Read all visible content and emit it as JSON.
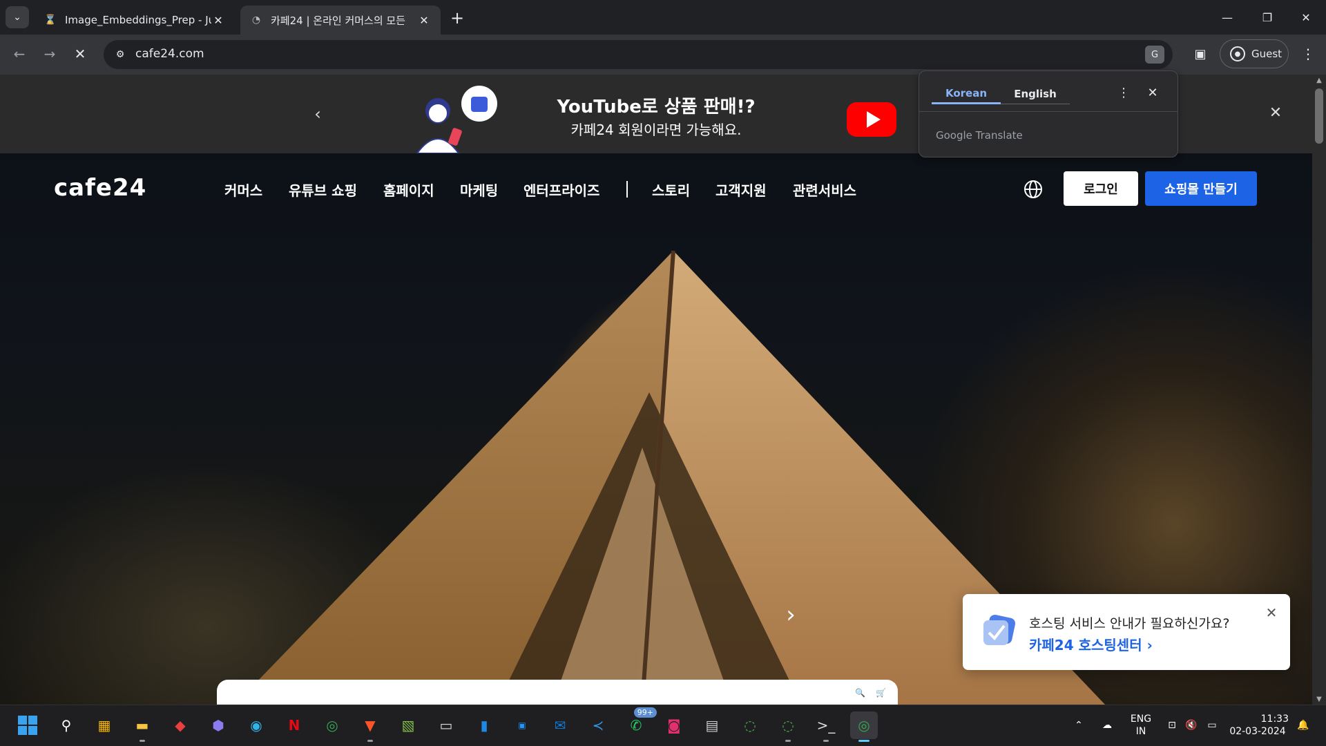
{
  "browser": {
    "tabs": [
      {
        "title": "Image_Embeddings_Prep - Jupy",
        "favicon": "hourglass-icon",
        "active": false
      },
      {
        "title": "카페24 | 온라인 커머스의 모든",
        "favicon": "loading-icon",
        "active": true
      }
    ],
    "url": "cafe24.com",
    "profile_label": "Guest"
  },
  "translate_popup": {
    "source_lang": "Korean",
    "target_lang": "English",
    "brand": "Google Translate"
  },
  "banner": {
    "title": "YouTube로 상품 판매!?",
    "subtitle": "카페24 회원이라면 가능해요."
  },
  "site": {
    "logo": "cafe24",
    "nav": [
      "커머스",
      "유튜브 쇼핑",
      "홈페이지",
      "마케팅",
      "엔터프라이즈",
      "스토리",
      "고객지원",
      "관련서비스"
    ],
    "login_label": "로그인",
    "create_label": "쇼핑몰 만들기"
  },
  "hosting_popup": {
    "question": "호스팅 서비스 안내가 필요하신가요?",
    "link": "카페24 호스팅센터"
  },
  "taskbar": {
    "whatsapp_badge": "99+",
    "lang_line1": "ENG",
    "lang_line2": "IN",
    "time": "11:33",
    "date": "02-03-2024"
  },
  "colors": {
    "accent_blue": "#1d63e6",
    "youtube_red": "#ff0000",
    "chrome_dark": "#202124"
  }
}
